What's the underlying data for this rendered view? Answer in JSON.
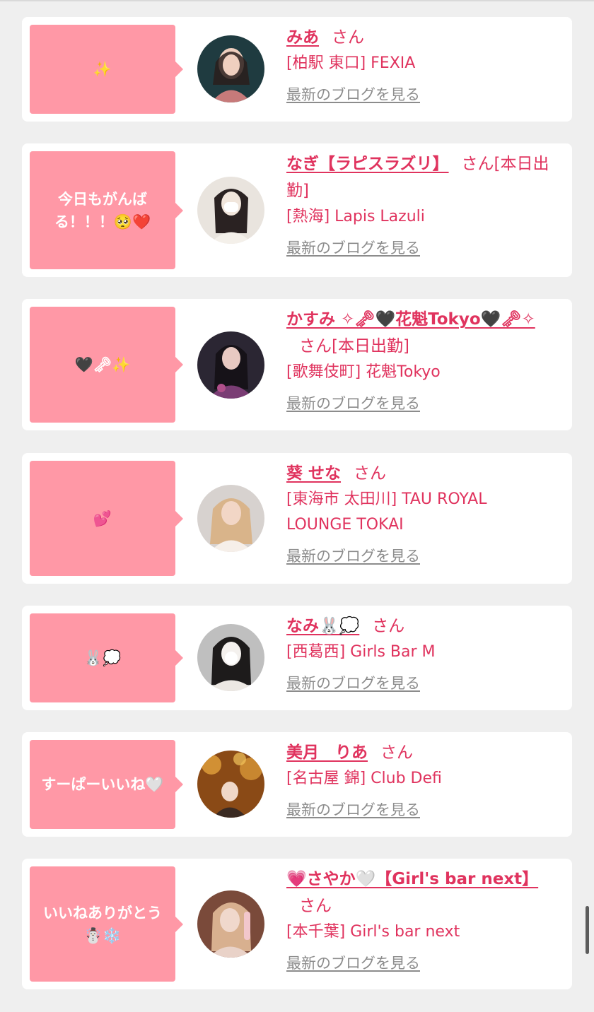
{
  "cards": [
    {
      "message": "✨",
      "name": "みあ",
      "san": "さん",
      "extra": "",
      "shop": "[柏駅 東口] FEXIA",
      "blog_link": "最新のブログを見る",
      "avatar_colors": [
        "#1f3b40",
        "#c77a7a",
        "#efcfbf"
      ]
    },
    {
      "message": "今日もがんば\nる！！！🥺❤️",
      "name": "なぎ【ラピスラズリ】",
      "san": "さん",
      "extra": "[本日出勤]",
      "shop": "[熱海] Lapis Lazuli",
      "blog_link": "最新のブログを見る",
      "avatar_colors": [
        "#e9e4de",
        "#2a2222",
        "#f1e6dc"
      ]
    },
    {
      "message": "🖤🗝✨",
      "name": "かすみ ✧🗝🖤花魁Tokyo🖤🗝✧",
      "san": "さん",
      "extra": "[本日出勤]",
      "shop": "[歌舞伎町] 花魁Tokyo",
      "blog_link": "最新のブログを見る",
      "avatar_colors": [
        "#2b2633",
        "#7a3d74",
        "#e8c9c2"
      ]
    },
    {
      "message": "💕",
      "name": "葵 せな",
      "san": "さん",
      "extra": "",
      "shop": "[東海市 太田川] TAU ROYAL LOUNGE TOKAI",
      "blog_link": "最新のブログを見る",
      "avatar_colors": [
        "#d7d2cf",
        "#d9b48a",
        "#f2d6c6"
      ]
    },
    {
      "message": "🐰💭",
      "name": "なみ🐰💭",
      "san": "さん",
      "extra": "",
      "shop": "[西葛西] Girls Bar M",
      "blog_link": "最新のブログを見る",
      "avatar_colors": [
        "#bfbfbf",
        "#1d1b1b",
        "#f4f1ee"
      ]
    },
    {
      "message": "すーぱーいいね🤍",
      "name": "美月　りあ",
      "san": "さん",
      "extra": "",
      "shop": "[名古屋 錦] Club Defi",
      "blog_link": "最新のブログを見る",
      "avatar_colors": [
        "#8a4a16",
        "#e2a13c",
        "#3a2a22"
      ]
    },
    {
      "message": "いいねありがとう\n☃️❄️",
      "name": "💗さやか🤍【Girl's bar next】",
      "san": "さん",
      "extra": "",
      "shop": "[本千葉] Girl's bar next",
      "blog_link": "最新のブログを見る",
      "avatar_colors": [
        "#7a4a3a",
        "#d8b08f",
        "#f0d8cc"
      ]
    }
  ]
}
